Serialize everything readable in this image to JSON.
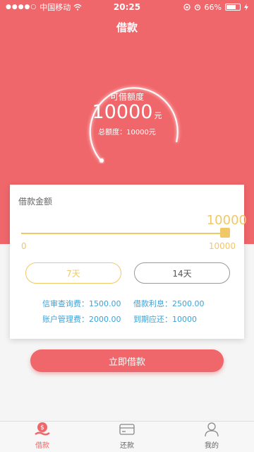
{
  "status": {
    "carrier": "中国移动",
    "time": "20:25",
    "battery": "66%"
  },
  "header": {
    "title": "借款"
  },
  "circle": {
    "label": "可借额度",
    "amount": "10000",
    "unit": "元",
    "total": "总额度：10000元"
  },
  "card": {
    "title": "借款金额",
    "current_value": "10000",
    "slider_fraction": 1.0,
    "min": "0",
    "max": "10000",
    "term_7": "7天",
    "term_14": "14天",
    "info_review_fee": "信审查询费：1500.00",
    "info_interest": "借款利息：2500.00",
    "info_mgmt_fee": "账户管理费：2000.00",
    "info_due": "到期应还：10000"
  },
  "cta": {
    "label": "立即借款"
  },
  "tabs": [
    {
      "label": "借款"
    },
    {
      "label": "还款"
    },
    {
      "label": "我的"
    }
  ]
}
